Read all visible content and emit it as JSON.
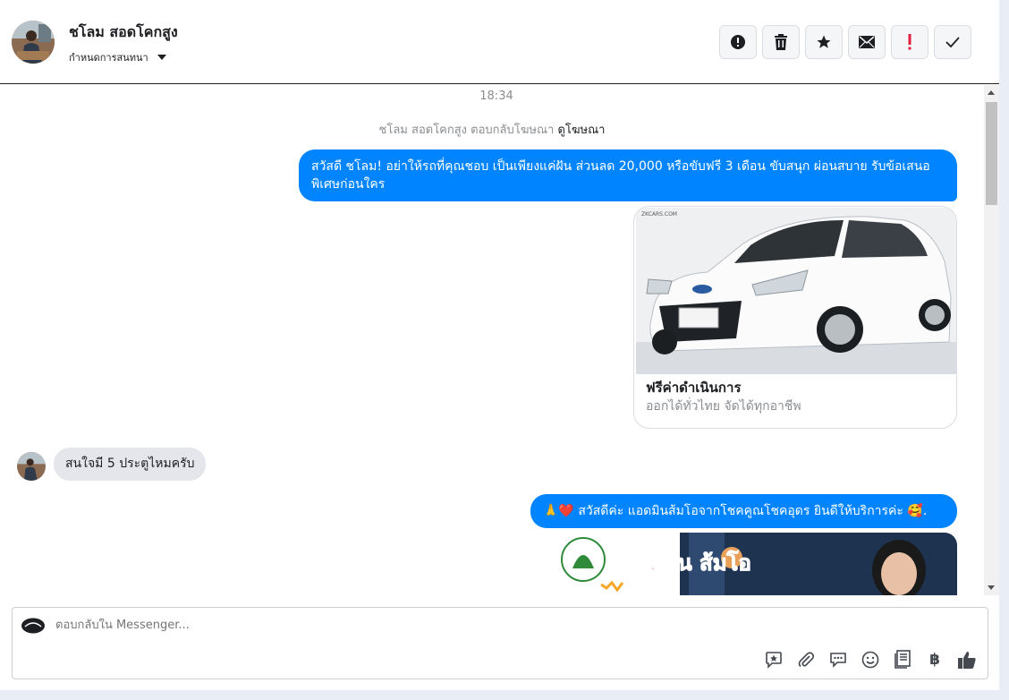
{
  "header": {
    "contact_name": "ชโลม สอดโคกสูง",
    "assign_label": "กำหนดการสนทนา",
    "actions": [
      {
        "icon": "alert-circle-icon",
        "name": "mark-spam-button"
      },
      {
        "icon": "trash-icon",
        "name": "delete-button"
      },
      {
        "icon": "star-icon",
        "name": "star-button"
      },
      {
        "icon": "envelope-icon",
        "name": "mark-unread-button"
      },
      {
        "icon": "exclamation-icon",
        "name": "follow-up-button"
      },
      {
        "icon": "check-icon",
        "name": "mark-done-button"
      }
    ]
  },
  "conversation": {
    "timestamp": "18:34",
    "ad_reply_text": "ชโลม สอดโคกสูง ตอบกลับโฆษณา",
    "ad_reply_link": "ดูโฆษณา",
    "messages": [
      {
        "direction": "out",
        "text": "สวัสดี ชโลม! อย่าให้รถที่คุณชอบ เป็นเพียงแค่ฝัน ส่วนลด 20,000 หรือขับฟรี 3 เดือน ขับสนุก ผ่อนสบาย รับข้อเสนอพิเศษก่อนใคร"
      },
      {
        "direction": "out",
        "type": "card",
        "image_caption": "ZKCARS.COM",
        "title": "ฟรีค่าดำเนินการ",
        "subtitle": "ออกได้ทั่วไทย จัดได้ทุกอาชีพ"
      },
      {
        "direction": "in",
        "text": "สนใจมี 5 ประตูไหมครับ"
      },
      {
        "direction": "out",
        "text": "สวัสดีค่ะ แอดมินส้มโอจากโชคคูณโชคอุดร ยินดีให้บริการค่ะ",
        "emoji_prefix": "🙏❤️",
        "emoji_suffix": "🥰."
      },
      {
        "direction": "out",
        "type": "banner",
        "banner_text": "แอดมิน ส้มโอ"
      }
    ]
  },
  "composer": {
    "placeholder": "ตอบกลับใน Messenger...",
    "tools": [
      "saved-reply-icon",
      "paperclip-icon",
      "chat-bubbles-icon",
      "smiley-icon",
      "notes-icon",
      "baht-icon",
      "thumbs-up-icon"
    ],
    "baht_symbol": "฿"
  },
  "colors": {
    "accent": "#0084ff",
    "incoming_bubble": "#e4e6eb",
    "page_bg": "#e9edf6"
  }
}
